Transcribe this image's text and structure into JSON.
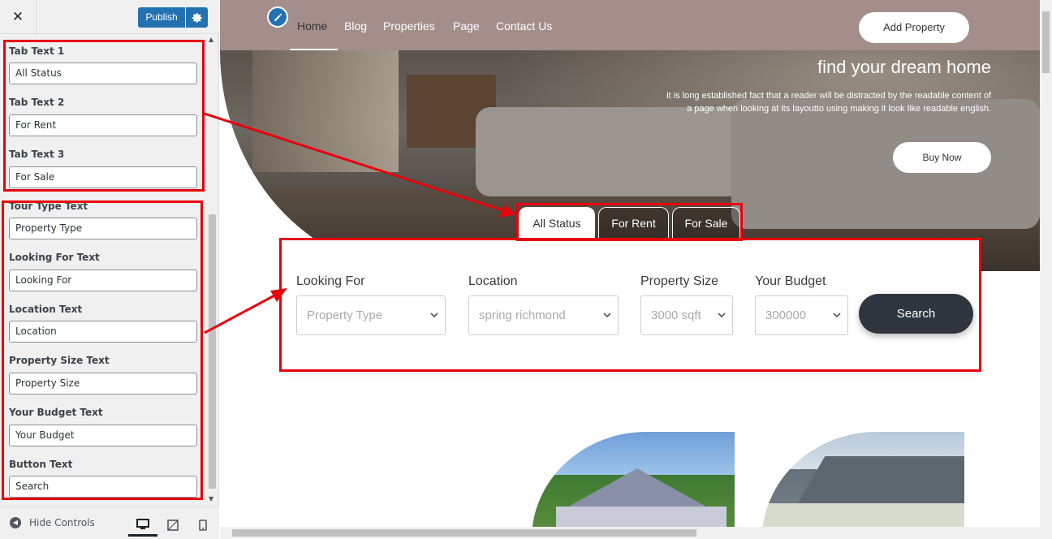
{
  "sidebar": {
    "publish_label": "Publish",
    "fields": [
      {
        "label": "Tab Text 1",
        "value": "All Status"
      },
      {
        "label": "Tab Text 2",
        "value": "For Rent"
      },
      {
        "label": "Tab Text 3",
        "value": "For Sale"
      },
      {
        "label": "Tour Type Text",
        "value": "Property Type"
      },
      {
        "label": "Looking For Text",
        "value": "Looking For"
      },
      {
        "label": "Location Text",
        "value": "Location"
      },
      {
        "label": "Property Size Text",
        "value": "Property Size"
      },
      {
        "label": "Your Budget Text",
        "value": "Your Budget"
      },
      {
        "label": "Button Text",
        "value": "Search"
      }
    ],
    "hide_controls_label": "Hide Controls"
  },
  "preview": {
    "nav": [
      "Home",
      "Blog",
      "Properties",
      "Page",
      "Contact Us"
    ],
    "add_property": "Add Property",
    "hero_title": "find your dream home",
    "hero_text": "it is long established fact that a reader will be distracted by the readable content of a page when looking at its layoutto using making it look like readable english.",
    "buy_now": "Buy Now",
    "tabs": [
      "All Status",
      "For Rent",
      "For Sale"
    ],
    "search": {
      "fields": [
        {
          "label": "Looking For",
          "value": "Property Type"
        },
        {
          "label": "Location",
          "value": "spring richmond"
        },
        {
          "label": "Property Size",
          "value": "3000 sqft"
        },
        {
          "label": "Your Budget",
          "value": "300000"
        }
      ],
      "button": "Search"
    }
  },
  "colors": {
    "accent": "#2271b1",
    "annotation_red": "#e8000b",
    "nav_bg": "#a38e8c",
    "search_button": "#2f3640"
  }
}
